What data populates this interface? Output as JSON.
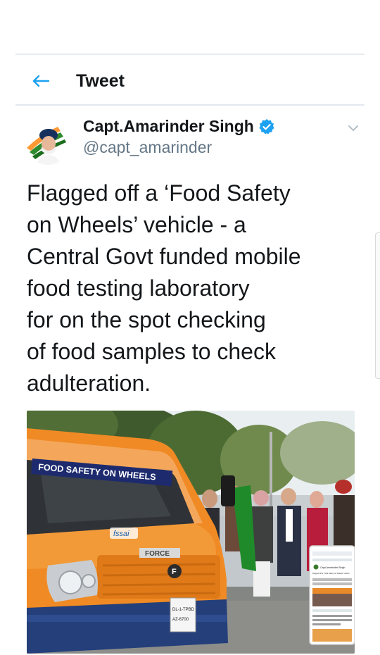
{
  "header": {
    "title": "Tweet"
  },
  "author": {
    "display_name": "Capt.Amarinder Singh",
    "handle": "@capt_amarinder"
  },
  "tweet": {
    "text": "Flagged off a ‘Food Safety\non Wheels’ vehicle - a\nCentral Govt funded mobile\nfood testing laboratory\nfor on the spot checking\nof food samples to check\nadulteration."
  },
  "media": {
    "banner_text": "FOOD SAFETY ON WHEELS",
    "grille_brand": "FORCE",
    "plate_line1": "DL-1-TPBD",
    "plate_line2": "AZ-6700",
    "door_logo": "fssai",
    "inset_lines": [
      "Capt.Amarinder Singh",
      "Flagged off a 'Food Safety on Wheels' vehicle"
    ]
  },
  "colors": {
    "accent": "#1da1f2",
    "van_orange": "#f08a24",
    "text_secondary": "#657786"
  }
}
